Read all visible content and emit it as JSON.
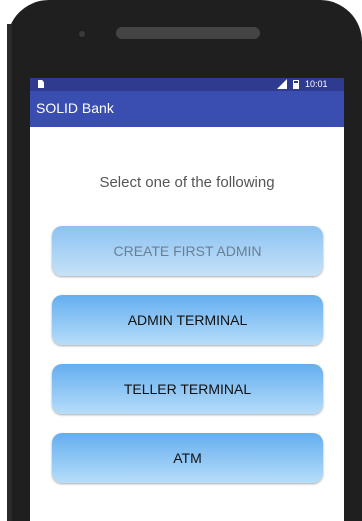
{
  "status_bar": {
    "time": "10:01",
    "icons": [
      "sim-card-icon",
      "signal-icon",
      "battery-icon"
    ]
  },
  "app_bar": {
    "title": "SOLID Bank"
  },
  "main": {
    "prompt": "Select one of the following",
    "buttons": [
      {
        "label": "CREATE FIRST ADMIN",
        "enabled": false
      },
      {
        "label": "ADMIN TERMINAL",
        "enabled": true
      },
      {
        "label": "TELLER TERMINAL",
        "enabled": true
      },
      {
        "label": "ATM",
        "enabled": true
      }
    ]
  },
  "colors": {
    "status_bar": "#2f3b8f",
    "app_bar": "#3a4db0",
    "button_top": "#64aef0",
    "button_bottom": "#b7ddf9",
    "phone_body": "#1f1f1f"
  }
}
